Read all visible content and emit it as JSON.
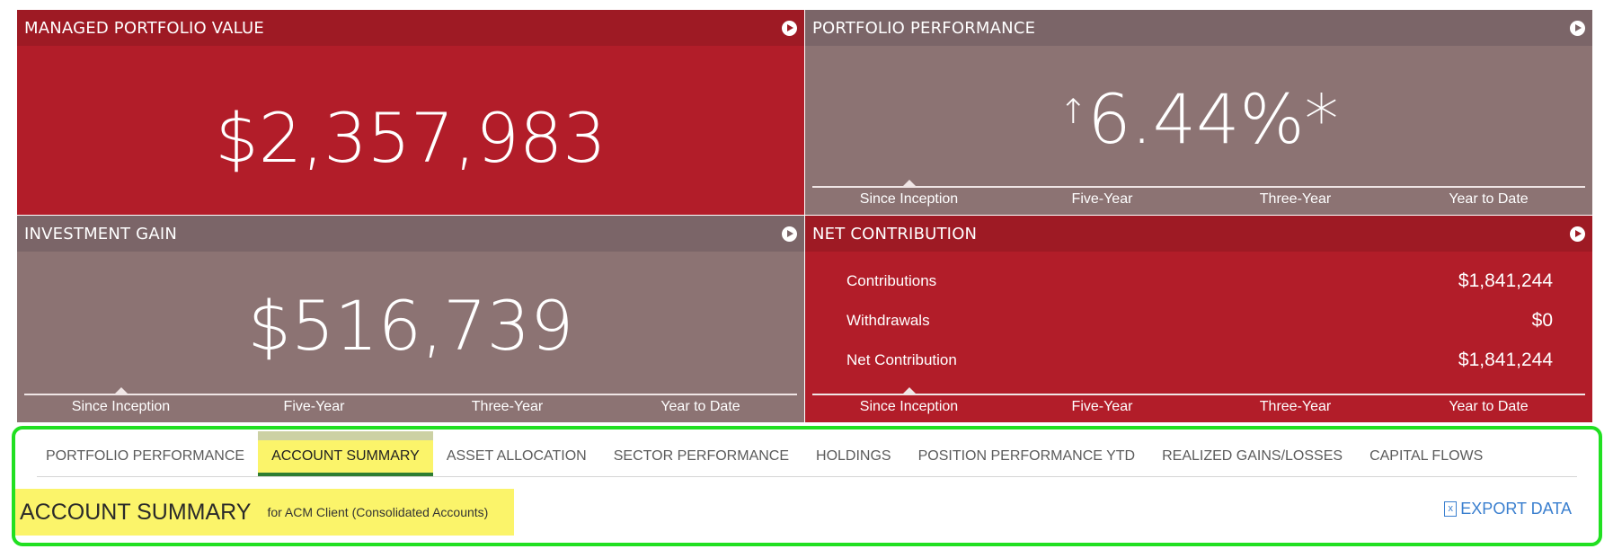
{
  "tiles": {
    "managed_value": {
      "title": "MANAGED PORTFOLIO VALUE",
      "value": "$2,357,983",
      "icon": "arrow-right-circle-icon"
    },
    "portfolio_performance": {
      "title": "PORTFOLIO PERFORMANCE",
      "arrow": "↑",
      "value": "6.44%*",
      "icon": "arrow-right-circle-icon",
      "periods": [
        "Since Inception",
        "Five-Year",
        "Three-Year",
        "Year to Date"
      ],
      "active_period": "Since Inception"
    },
    "investment_gain": {
      "title": "INVESTMENT GAIN",
      "value": "$516,739",
      "icon": "arrow-right-circle-icon",
      "periods": [
        "Since Inception",
        "Five-Year",
        "Three-Year",
        "Year to Date"
      ],
      "active_period": "Since Inception"
    },
    "net_contribution": {
      "title": "NET CONTRIBUTION",
      "icon": "arrow-right-circle-icon",
      "rows": [
        {
          "label": "Contributions",
          "value": "$1,841,244"
        },
        {
          "label": "Withdrawals",
          "value": "$0"
        },
        {
          "label": "Net Contribution",
          "value": "$1,841,244"
        }
      ],
      "periods": [
        "Since Inception",
        "Five-Year",
        "Three-Year",
        "Year to Date"
      ],
      "active_period": "Since Inception"
    }
  },
  "tabs": [
    "PORTFOLIO PERFORMANCE",
    "ACCOUNT SUMMARY",
    "ASSET ALLOCATION",
    "SECTOR PERFORMANCE",
    "HOLDINGS",
    "POSITION PERFORMANCE YTD",
    "REALIZED GAINS/LOSSES",
    "CAPITAL FLOWS"
  ],
  "active_tab": "ACCOUNT SUMMARY",
  "summary": {
    "title": "ACCOUNT SUMMARY",
    "subtitle": "for ACM Client (Consolidated Accounts)",
    "export_label": "EXPORT DATA",
    "export_icon": "excel-file-icon"
  },
  "colors": {
    "red": "#b21d29",
    "red_header": "#9e1a24",
    "mauve": "#8c7373",
    "mauve_header": "#7b6568",
    "highlight": "#fbf46a",
    "focus_border": "#21e021",
    "link": "#3a7fcf"
  }
}
